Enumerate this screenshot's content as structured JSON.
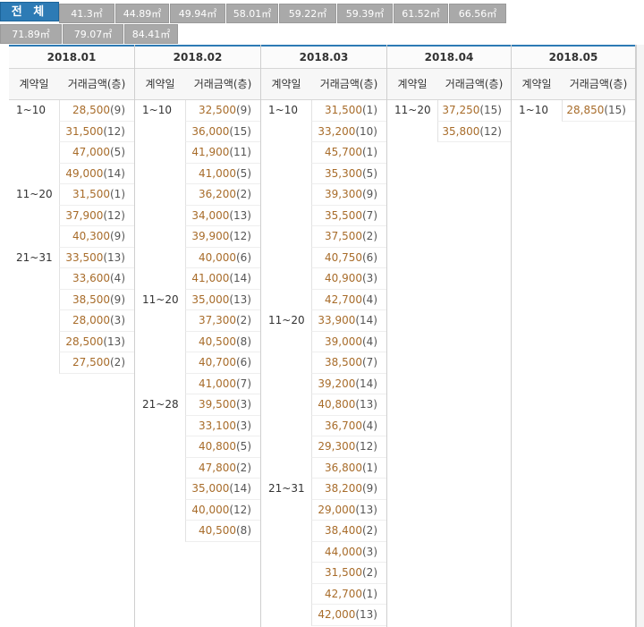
{
  "tabs": {
    "all": "전 체",
    "sizes": [
      "41.3㎡",
      "44.89㎡",
      "49.94㎡",
      "58.01㎡",
      "59.22㎡",
      "59.39㎡",
      "61.52㎡",
      "66.56㎡",
      "71.89㎡",
      "79.07㎡",
      "84.41㎡"
    ]
  },
  "headers": {
    "date": "계약일",
    "price": "거래금액(층)"
  },
  "months": [
    {
      "label": "2018.01",
      "groups": [
        {
          "range": "1~10",
          "rows": [
            [
              "28,500",
              "(9)"
            ],
            [
              "31,500",
              "(12)"
            ],
            [
              "47,000",
              "(5)"
            ],
            [
              "49,000",
              "(14)"
            ]
          ]
        },
        {
          "range": "11~20",
          "rows": [
            [
              "31,500",
              "(1)"
            ],
            [
              "37,900",
              "(12)"
            ],
            [
              "40,300",
              "(9)"
            ]
          ]
        },
        {
          "range": "21~31",
          "rows": [
            [
              "33,500",
              "(13)"
            ],
            [
              "33,600",
              "(4)"
            ],
            [
              "38,500",
              "(9)"
            ],
            [
              "28,000",
              "(3)"
            ],
            [
              "28,500",
              "(13)"
            ],
            [
              "27,500",
              "(2)"
            ]
          ]
        }
      ]
    },
    {
      "label": "2018.02",
      "groups": [
        {
          "range": "1~10",
          "rows": [
            [
              "32,500",
              "(9)"
            ],
            [
              "36,000",
              "(15)"
            ],
            [
              "41,900",
              "(11)"
            ],
            [
              "41,000",
              "(5)"
            ],
            [
              "36,200",
              "(2)"
            ],
            [
              "34,000",
              "(13)"
            ],
            [
              "39,900",
              "(12)"
            ],
            [
              "40,000",
              "(6)"
            ],
            [
              "41,000",
              "(14)"
            ]
          ]
        },
        {
          "range": "11~20",
          "rows": [
            [
              "35,000",
              "(13)"
            ],
            [
              "37,300",
              "(2)"
            ],
            [
              "40,500",
              "(8)"
            ],
            [
              "40,700",
              "(6)"
            ],
            [
              "41,000",
              "(7)"
            ]
          ]
        },
        {
          "range": "21~28",
          "rows": [
            [
              "39,500",
              "(3)"
            ],
            [
              "33,100",
              "(3)"
            ],
            [
              "40,800",
              "(5)"
            ],
            [
              "47,800",
              "(2)"
            ],
            [
              "35,000",
              "(14)"
            ],
            [
              "40,000",
              "(12)"
            ],
            [
              "40,500",
              "(8)"
            ]
          ]
        }
      ]
    },
    {
      "label": "2018.03",
      "groups": [
        {
          "range": "1~10",
          "rows": [
            [
              "31,500",
              "(1)"
            ],
            [
              "33,200",
              "(10)"
            ],
            [
              "45,700",
              "(1)"
            ],
            [
              "35,300",
              "(5)"
            ],
            [
              "39,300",
              "(9)"
            ],
            [
              "35,500",
              "(7)"
            ],
            [
              "37,500",
              "(2)"
            ],
            [
              "40,750",
              "(6)"
            ],
            [
              "40,900",
              "(3)"
            ],
            [
              "42,700",
              "(4)"
            ]
          ]
        },
        {
          "range": "11~20",
          "rows": [
            [
              "33,900",
              "(14)"
            ],
            [
              "39,000",
              "(4)"
            ],
            [
              "38,500",
              "(7)"
            ],
            [
              "39,200",
              "(14)"
            ],
            [
              "40,800",
              "(13)"
            ],
            [
              "36,700",
              "(4)"
            ],
            [
              "29,300",
              "(12)"
            ],
            [
              "36,800",
              "(1)"
            ]
          ]
        },
        {
          "range": "21~31",
          "rows": [
            [
              "38,200",
              "(9)"
            ],
            [
              "29,000",
              "(13)"
            ],
            [
              "38,400",
              "(2)"
            ],
            [
              "44,000",
              "(3)"
            ],
            [
              "31,500",
              "(2)"
            ],
            [
              "42,700",
              "(1)"
            ],
            [
              "42,000",
              "(13)"
            ]
          ]
        }
      ]
    },
    {
      "label": "2018.04",
      "groups": [
        {
          "range": "11~20",
          "rows": [
            [
              "37,250",
              "(15)"
            ],
            [
              "35,800",
              "(12)"
            ]
          ]
        }
      ]
    },
    {
      "label": "2018.05",
      "groups": [
        {
          "range": "1~10",
          "rows": [
            [
              "28,850",
              "(15)"
            ]
          ]
        }
      ]
    }
  ],
  "colors": {
    "active_tab": "#2d7bb5",
    "tab": "#a9a9a9",
    "price": "#a86c2a"
  }
}
